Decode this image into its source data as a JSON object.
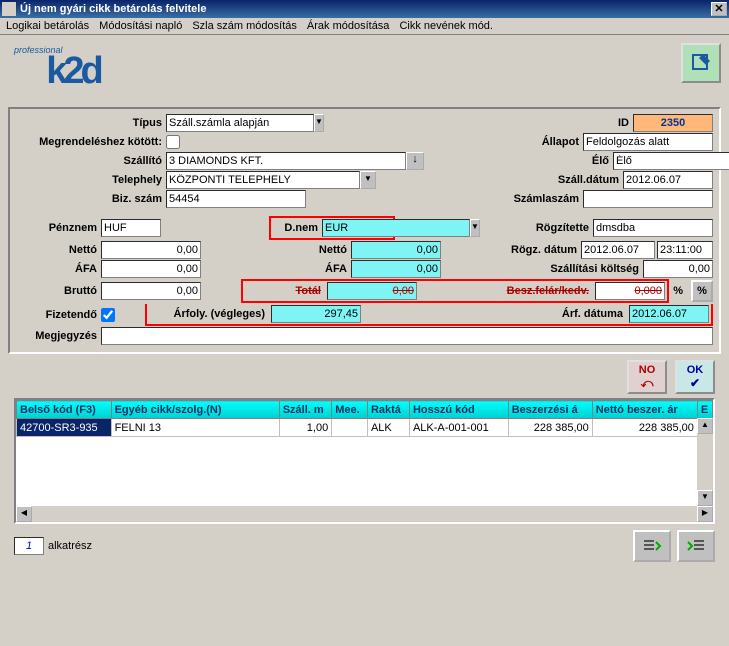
{
  "window": {
    "title": "Új nem gyári cikk betárolás felvitele"
  },
  "menu": {
    "m1": "Logikai betárolás",
    "m2": "Módosítási napló",
    "m3": "Szla szám módosítás",
    "m4": "Árak módosítása",
    "m5": "Cikk nevének mód."
  },
  "logo": {
    "professional": "professional",
    "brand": "k2d"
  },
  "labels": {
    "tipus": "Típus",
    "id": "ID",
    "megrend": "Megrendeléshez kötött:",
    "allapot": "Állapot",
    "szallito": "Szállító",
    "elo": "Élő",
    "telephely": "Telephely",
    "szall_datum": "Száll.dátum",
    "biz_szam": "Biz. szám",
    "szamlaszam": "Számlaszám",
    "penznem": "Pénznem",
    "dnem": "D.nem",
    "rogzitette": "Rögzítette",
    "netto": "Nettó",
    "afa": "ÁFA",
    "brutto": "Bruttó",
    "total": "Totál",
    "rogz_datum": "Rögz. dátum",
    "szall_koltseg": "Szállítási költség",
    "besz_felar": "Besz.felár/kedv.",
    "fizetendo": "Fizetendő",
    "arfoly": "Árfoly. (végleges)",
    "arf_datuma": "Árf. dátuma",
    "megjegyzes": "Megjegyzés",
    "pct": "%"
  },
  "values": {
    "tipus": "Száll.számla alapján",
    "id": "2350",
    "allapot": "Feldolgozás alatt",
    "szallito": "3 DIAMONDS KFT.",
    "elo": "Élő",
    "telephely": "KÖZPONTI TELEPHELY",
    "szall_datum": "2012.06.07",
    "biz_szam": "54454",
    "szamlaszam": "",
    "penznem": "HUF",
    "dnem": "EUR",
    "rogzitette": "dmsdba",
    "netto_l": "0,00",
    "afa_l": "0,00",
    "brutto_l": "0,00",
    "netto_c": "0,00",
    "afa_c": "0,00",
    "total_c": "0,00",
    "rogz_datum": "2012.06.07",
    "rogz_time": "23:11:00",
    "szall_koltseg": "0,00",
    "besz_felar": "0,000",
    "arfoly": "297,45",
    "arf_datuma": "2012.06.07",
    "megjegyzes": ""
  },
  "buttons": {
    "no": "NO",
    "ok": "OK"
  },
  "table": {
    "headers": {
      "h1": "Belső kód (F3)",
      "h2": "Egyéb cikk/szolg.(N)",
      "h3": "Száll. m",
      "h4": "Mee.",
      "h5": "Raktá",
      "h6": "Hosszú kód",
      "h7": "Beszerzési á",
      "h8": "Nettó beszer. ár",
      "h9": "E"
    },
    "row": {
      "c1": "42700-SR3-935",
      "c2": "FELNI 13",
      "c3": "1,00",
      "c4": "",
      "c5": "ALK",
      "c6": "ALK-A-001-001",
      "c7": "228 385,00",
      "c8": "228 385,00"
    }
  },
  "footer": {
    "page": "1",
    "label": "alkatrész"
  }
}
